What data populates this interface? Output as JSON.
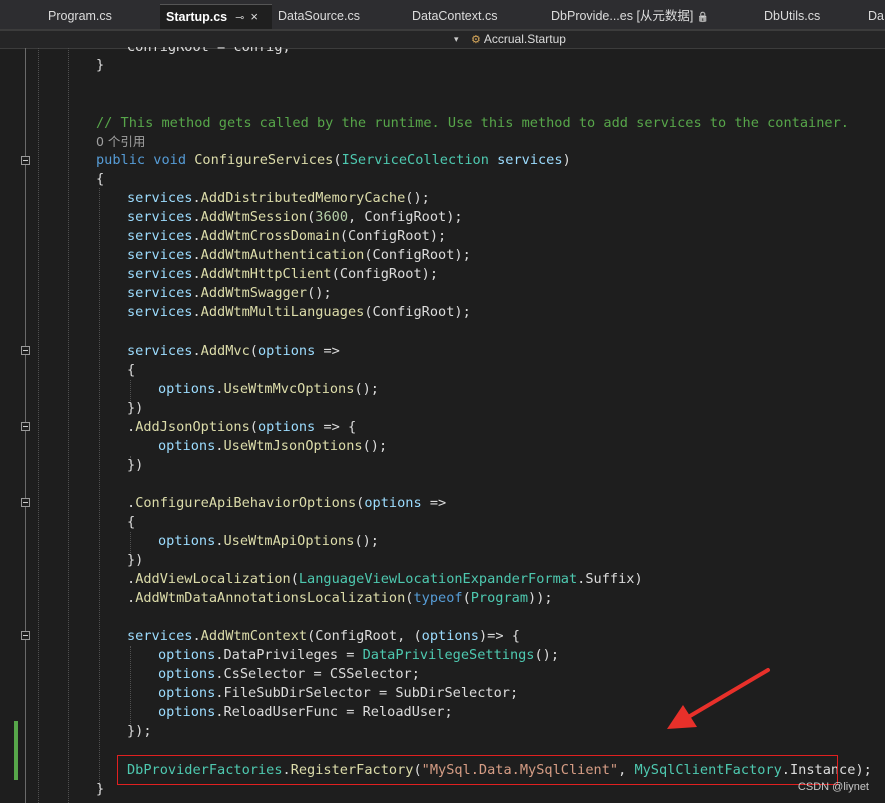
{
  "tabs": [
    {
      "label": "Program.cs",
      "active": false
    },
    {
      "label": "Startup.cs",
      "active": true,
      "pin": "⊸",
      "close": "×"
    },
    {
      "label": "DataSource.cs",
      "active": false
    },
    {
      "label": "DataContext.cs",
      "active": false
    },
    {
      "label": "DbProvide...es [从元数据]",
      "active": false,
      "lock": "🔒"
    },
    {
      "label": "DbUtils.cs",
      "active": false
    },
    {
      "label": "Da",
      "active": false
    }
  ],
  "nav": {
    "dropdown_glyph": "▾",
    "class_label": "Accrual.Startup"
  },
  "code": {
    "partial_top": "ConfigRoot = config;",
    "close_brace_1": "}",
    "comment": "// This method gets called by the runtime. Use this method to add services to the container.",
    "references": "0 个引用",
    "kw_public": "public",
    "kw_void": "void",
    "method_name": "ConfigureServices",
    "param_type": "IServiceCollection",
    "param_name": "services",
    "open_brace": "{",
    "services": "services",
    "options": "options",
    "m1": "AddDistributedMemoryCache",
    "m2": "AddWtmSession",
    "m2_num": "3600",
    "config_root": "ConfigRoot",
    "m3": "AddWtmCrossDomain",
    "m4": "AddWtmAuthentication",
    "m5": "AddWtmHttpClient",
    "m6": "AddWtmSwagger",
    "m7": "AddWtmMultiLanguages",
    "m8": "AddMvc",
    "lambda": "=>",
    "m9": "UseWtmMvcOptions",
    "close_paren": "})",
    "m10": "AddJsonOptions",
    "m11": "UseWtmJsonOptions",
    "m12": "ConfigureApiBehaviorOptions",
    "m13": "UseWtmApiOptions",
    "m14": "AddViewLocalization",
    "lang_format": "LanguageViewLocationExpanderFormat",
    "suffix": "Suffix",
    "m15": "AddWtmDataAnnotationsLocalization",
    "kw_typeof": "typeof",
    "program": "Program",
    "m16": "AddWtmContext",
    "p_data_priv": "DataPrivileges",
    "data_priv_settings": "DataPrivilegeSettings",
    "p_cs_selector": "CsSelector",
    "cs_selector": "CSSelector",
    "p_file_sub": "FileSubDirSelector",
    "sub_dir": "SubDirSelector",
    "p_reload": "ReloadUserFunc",
    "reload_user": "ReloadUser",
    "close_stmt": "});",
    "factories": "DbProviderFactories",
    "register": "RegisterFactory",
    "provider_string": "\"MySql.Data.MySqlClient\"",
    "client_factory": "MySqlClientFactory",
    "instance": "Instance",
    "close_brace_2": "}"
  },
  "annotation": {
    "arrow_color": "#e8302a",
    "box_color": "#e02020"
  },
  "watermark": "CSDN @liynet"
}
